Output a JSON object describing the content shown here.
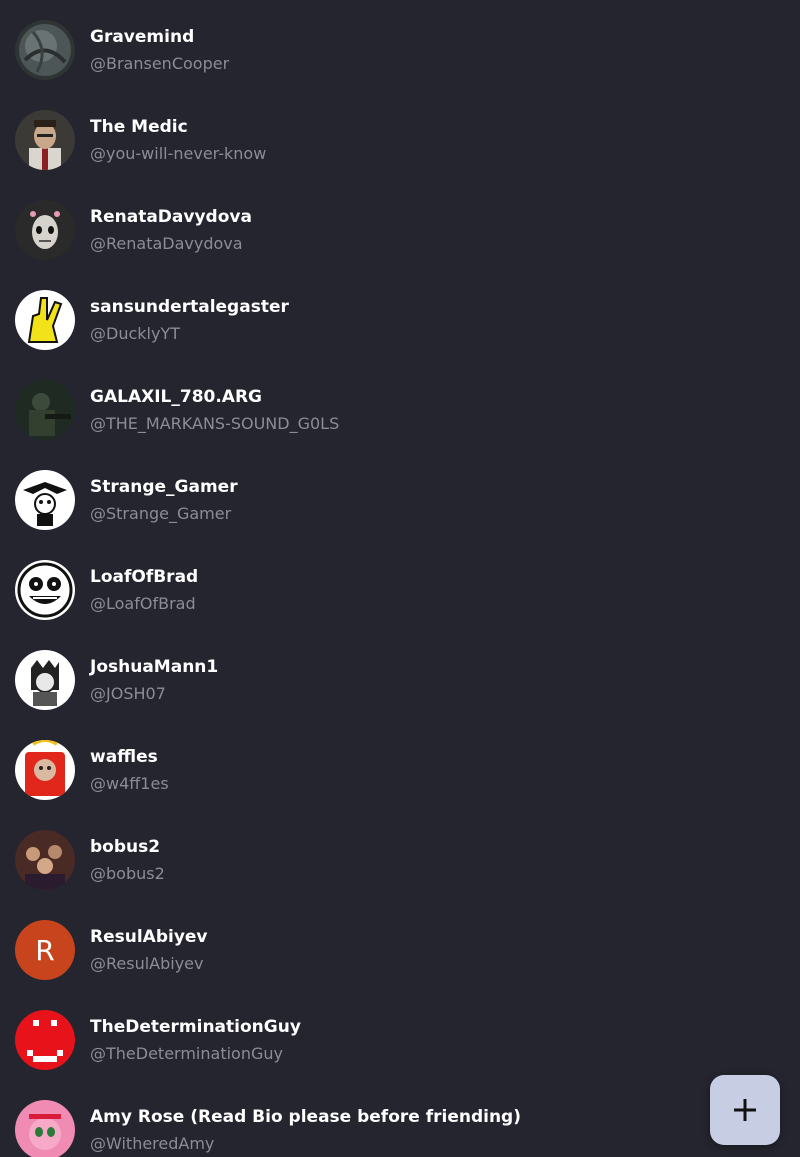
{
  "friends": [
    {
      "name": "Gravemind",
      "handle": "@BransenCooper",
      "avatar": "gravemind-avatar"
    },
    {
      "name": "The Medic",
      "handle": "@you-will-never-know",
      "avatar": "medic-avatar"
    },
    {
      "name": "RenataDavydova",
      "handle": "@RenataDavydova",
      "avatar": "renata-avatar"
    },
    {
      "name": "sansundertalegaster",
      "handle": "@DucklyYT",
      "avatar": "yellow-hand-avatar"
    },
    {
      "name": "GALAXIL_780.ARG",
      "handle": "@THE_MARKANS-SOUND_G0LS",
      "avatar": "soldier-avatar"
    },
    {
      "name": "Strange_Gamer",
      "handle": "@Strange_Gamer",
      "avatar": "jester-avatar"
    },
    {
      "name": "LoafOfBrad",
      "handle": "@LoafOfBrad",
      "avatar": "grin-face-avatar"
    },
    {
      "name": "JoshuaMann1",
      "handle": "@JOSH07",
      "avatar": "drawn-character-avatar"
    },
    {
      "name": "waffles",
      "handle": "@w4ff1es",
      "avatar": "cat-in-box-avatar"
    },
    {
      "name": "bobus2",
      "handle": "@bobus2",
      "avatar": "crowd-photo-avatar"
    },
    {
      "name": "ResulAbiyev",
      "handle": "@ResulAbiyev",
      "avatar": "letter-avatar",
      "initial": "R"
    },
    {
      "name": "TheDeterminationGuy",
      "handle": "@TheDeterminationGuy",
      "avatar": "red-pixel-avatar"
    },
    {
      "name": "Amy Rose (Read Bio please before friending)",
      "handle": "@WitheredAmy",
      "avatar": "pink-hedgehog-avatar"
    }
  ],
  "fab": {
    "icon": "plus-icon"
  },
  "colors": {
    "background": "#24252f",
    "name_text": "#ffffff",
    "handle_text": "#8b8c96",
    "fab_background": "#c7cde2",
    "letter_avatar": "#c7441c"
  }
}
